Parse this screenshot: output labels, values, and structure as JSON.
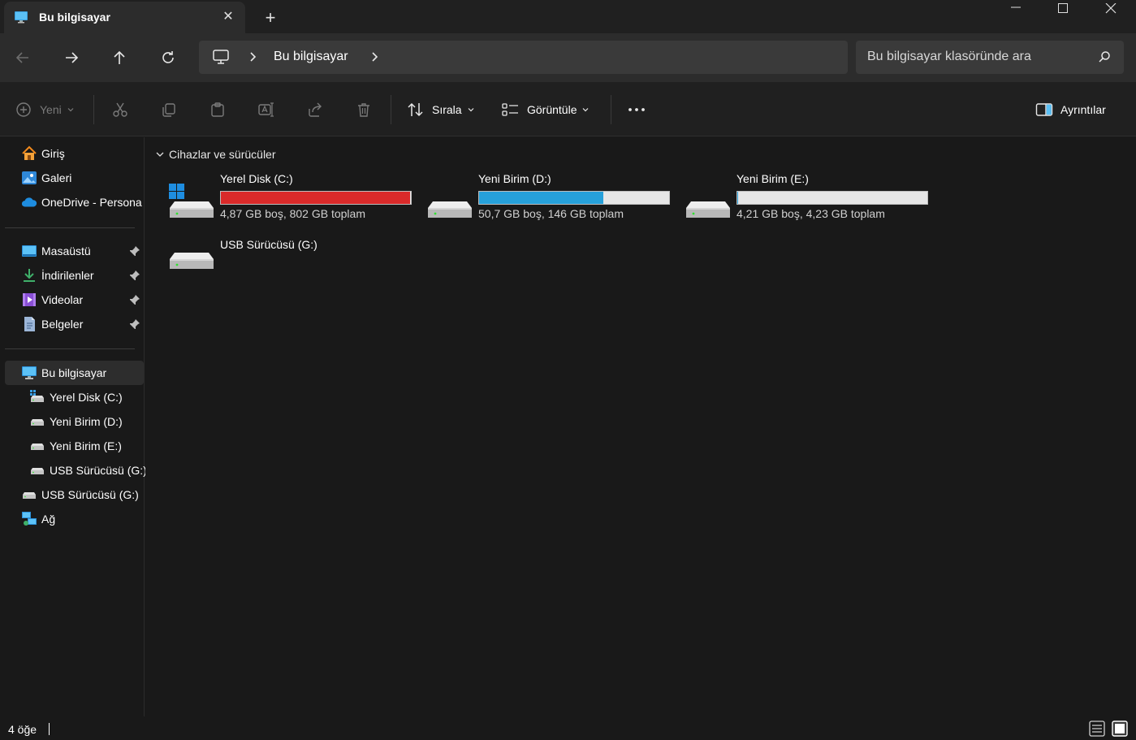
{
  "window": {
    "tab_title": "Bu bilgisayar"
  },
  "address": {
    "path": "Bu bilgisayar",
    "search_placeholder": "Bu bilgisayar klasöründe ara"
  },
  "toolbar": {
    "new_label": "Yeni",
    "sort_label": "Sırala",
    "view_label": "Görüntüle",
    "details_label": "Ayrıntılar"
  },
  "sidebar": {
    "quick": [
      {
        "label": "Giriş",
        "icon": "home-icon"
      },
      {
        "label": "Galeri",
        "icon": "gallery-icon"
      },
      {
        "label": "OneDrive - Persona",
        "icon": "cloud-icon"
      }
    ],
    "pinned": [
      {
        "label": "Masaüstü",
        "icon": "desktop-icon"
      },
      {
        "label": "İndirilenler",
        "icon": "download-icon"
      },
      {
        "label": "Videolar",
        "icon": "videos-icon"
      },
      {
        "label": "Belgeler",
        "icon": "documents-icon"
      }
    ],
    "this_pc": "Bu bilgisayar",
    "drives": [
      {
        "label": "Yerel Disk (C:)"
      },
      {
        "label": "Yeni Birim (D:)"
      },
      {
        "label": "Yeni Birim (E:)"
      },
      {
        "label": "USB Sürücüsü (G:)"
      }
    ],
    "usb": "USB Sürücüsü (G:)",
    "network": "Ağ"
  },
  "main": {
    "group_title": "Cihazlar ve sürücüler",
    "drives": [
      {
        "name": "Yerel Disk (C:)",
        "space": "4,87 GB boş, 802 GB toplam",
        "used_fraction": 0.994,
        "fill_color": "#da2a2a"
      },
      {
        "name": "Yeni Birim (D:)",
        "space": "50,7 GB boş, 146 GB toplam",
        "used_fraction": 0.653,
        "fill_color": "#26a0da"
      },
      {
        "name": "Yeni Birim (E:)",
        "space": "4,21 GB boş, 4,23 GB toplam",
        "used_fraction": 0.005,
        "fill_color": "#26a0da"
      },
      {
        "name": "USB Sürücüsü (G:)"
      }
    ]
  },
  "status": {
    "item_count": "4 öğe"
  }
}
